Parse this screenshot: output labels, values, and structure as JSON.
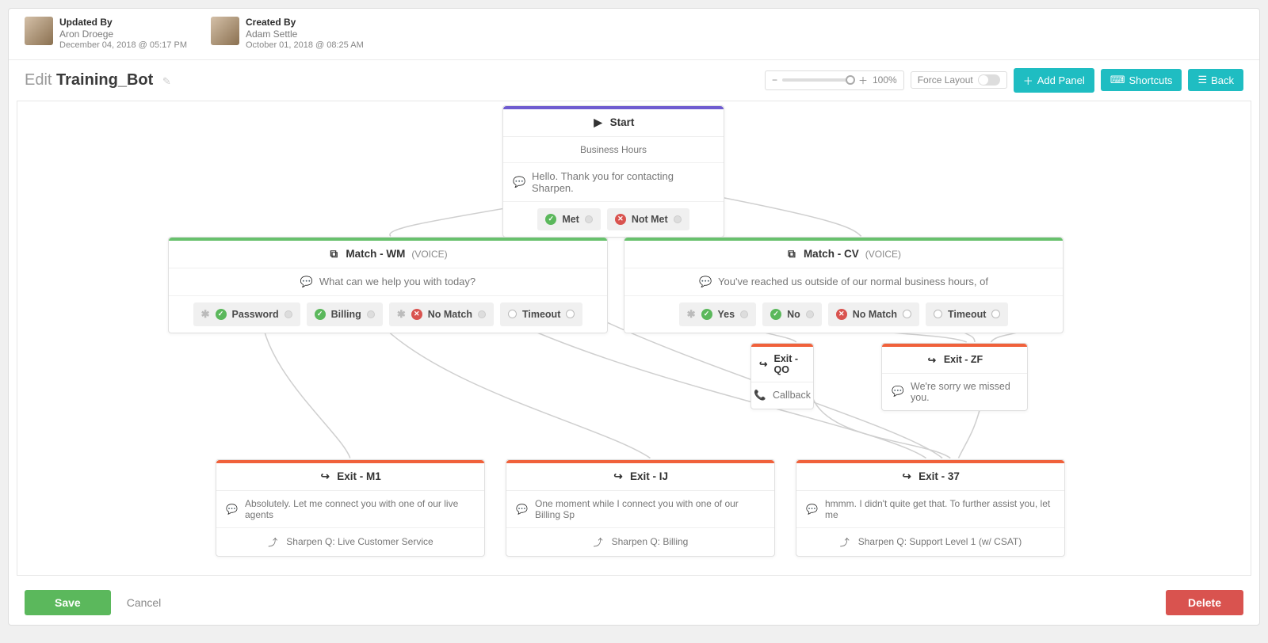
{
  "meta": {
    "updated_by_label": "Updated By",
    "updated_by_name": "Aron Droege",
    "updated_by_date": "December 04, 2018 @ 05:17 PM",
    "created_by_label": "Created By",
    "created_by_name": "Adam Settle",
    "created_by_date": "October 01, 2018 @ 08:25 AM"
  },
  "title": {
    "edit": "Edit",
    "name": "Training_Bot"
  },
  "toolbar": {
    "zoom_value": "100%",
    "force_layout": "Force Layout",
    "add_panel": "Add Panel",
    "shortcuts": "Shortcuts",
    "back": "Back"
  },
  "nodes": {
    "start": {
      "title": "Start",
      "sub": "Business Hours",
      "message": "Hello. Thank you for contacting Sharpen.",
      "opt_met": "Met",
      "opt_notmet": "Not Met"
    },
    "match_wm": {
      "title": "Match - WM",
      "voice": "(VOICE)",
      "message": "What can we help you with today?",
      "opt_password": "Password",
      "opt_billing": "Billing",
      "opt_nomatch": "No Match",
      "opt_timeout": "Timeout"
    },
    "match_cv": {
      "title": "Match - CV",
      "voice": "(VOICE)",
      "message": "You've reached us outside of our normal business hours, of",
      "opt_yes": "Yes",
      "opt_no": "No",
      "opt_nomatch": "No Match",
      "opt_timeout": "Timeout"
    },
    "exit_qo": {
      "title": "Exit - QO",
      "detail": "Callback"
    },
    "exit_zf": {
      "title": "Exit - ZF",
      "message": "We're sorry we missed you."
    },
    "exit_m1": {
      "title": "Exit - M1",
      "message": "Absolutely. Let me connect you with one of our live agents",
      "route": "Sharpen Q: Live Customer Service"
    },
    "exit_ij": {
      "title": "Exit - IJ",
      "message": "One moment while I connect you with one of our Billing Sp",
      "route": "Sharpen Q: Billing"
    },
    "exit_37": {
      "title": "Exit - 37",
      "message": "hmmm. I didn't quite get that. To further assist you, let me",
      "route": "Sharpen Q: Support Level 1 (w/ CSAT)"
    }
  },
  "footer": {
    "save": "Save",
    "cancel": "Cancel",
    "delete": "Delete"
  },
  "icons": {
    "play": "▶",
    "copy": "⧉",
    "exit": "↪",
    "chat": "💬",
    "phone": "📞",
    "share": "⤴",
    "check": "✓",
    "x": "✕",
    "pencil": "✎",
    "list": "☰",
    "keyboard": "⌨",
    "plus": "＋",
    "minus": "−"
  }
}
